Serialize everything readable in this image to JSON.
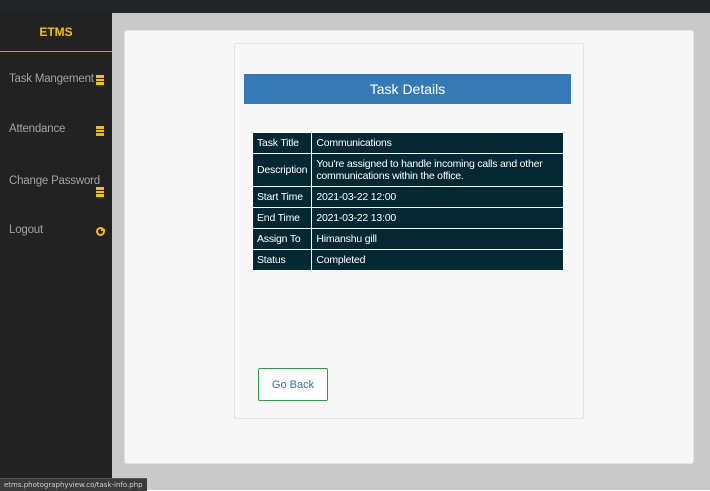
{
  "sidebar": {
    "brand": "ETMS",
    "items": [
      {
        "label": "Task Mangement",
        "icon": "list-icon"
      },
      {
        "label": "Attendance",
        "icon": "list-icon"
      },
      {
        "label": "Change Password",
        "icon": "list-icon"
      },
      {
        "label": "Logout",
        "icon": "logout-icon"
      }
    ]
  },
  "main": {
    "title": "Task Details",
    "rows": [
      {
        "key": "Task Title",
        "value": "Communications"
      },
      {
        "key": "Description",
        "value": "You're assigned to handle incoming calls and other communications within the office."
      },
      {
        "key": "Start Time",
        "value": "2021-03-22 12:00"
      },
      {
        "key": "End Time",
        "value": "2021-03-22 13:00"
      },
      {
        "key": "Assign To",
        "value": "Himanshu gill"
      },
      {
        "key": "Status",
        "value": "Completed"
      }
    ],
    "back_button": "Go Back"
  },
  "status_bar": {
    "url": "etms.photographyview.co/task-info.php"
  },
  "colors": {
    "accent": "#f5c000",
    "header": "#347ab7",
    "table_bg": "#032833",
    "sidebar_bg": "#222222",
    "button_border": "#2e9b48"
  }
}
